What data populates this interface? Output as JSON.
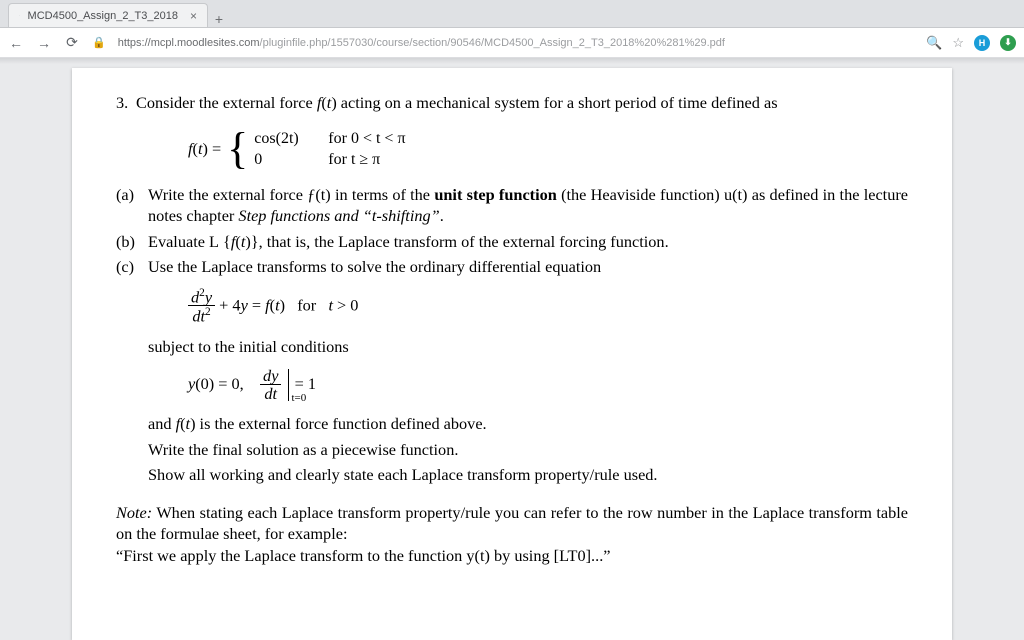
{
  "browser": {
    "tab_title": "MCD4500_Assign_2_T3_2018",
    "url_host": "https://mcpl.moodlesites.com",
    "url_path": "/pluginfile.php/1557030/course/section/90546/MCD4500_Assign_2_T3_2018%20%281%29.pdf",
    "profile_letter": "H"
  },
  "doc": {
    "q_num": "3.",
    "q_intro": "Consider the external force ƒ(t) acting on a mechanical system for a short period of time defined as",
    "piecewise": {
      "lhs": "ƒ(t) =",
      "case1_l": "cos(2t)",
      "case1_r": "for 0 < t < π",
      "case2_l": "0",
      "case2_r": "for t ≥ π"
    },
    "a": {
      "lbl": "(a)",
      "line1a": "Write the external force ƒ(t) in terms of the ",
      "line1b": "unit step function",
      "line1c": " (the Heaviside function) u(t) as defined in the lecture notes chapter ",
      "line1d": "Step functions and “t-shifting”",
      "line1e": "."
    },
    "b": {
      "lbl": "(b)",
      "text": "Evaluate ℒ{ƒ(t)}, that is, the Laplace transform of the external forcing function."
    },
    "c": {
      "lbl": "(c)",
      "text": "Use the Laplace transforms to solve the ordinary differential equation"
    },
    "ode": {
      "frac_n": "d²y",
      "frac_d": "dt²",
      "rest": " + 4y = ƒ(t) for t > 0"
    },
    "subject": "subject to the initial conditions",
    "ic": {
      "y0": "y(0) = 0,",
      "frac_n": "dy",
      "frac_d": "dt",
      "eval": "t=0",
      "rhs": " = 1"
    },
    "after1": "and ƒ(t) is the external force function defined above.",
    "after2": "Write the final solution as a piecewise function.",
    "after3": "Show all working and clearly state each Laplace transform property/rule used.",
    "note_label": "Note:",
    "note_body": " When stating each Laplace transform property/rule you can refer to the row number in the Laplace transform table on the formulae sheet, for example:",
    "note_ex": "“First we apply the Laplace transform to the function y(t) by using [LT0]...”"
  }
}
